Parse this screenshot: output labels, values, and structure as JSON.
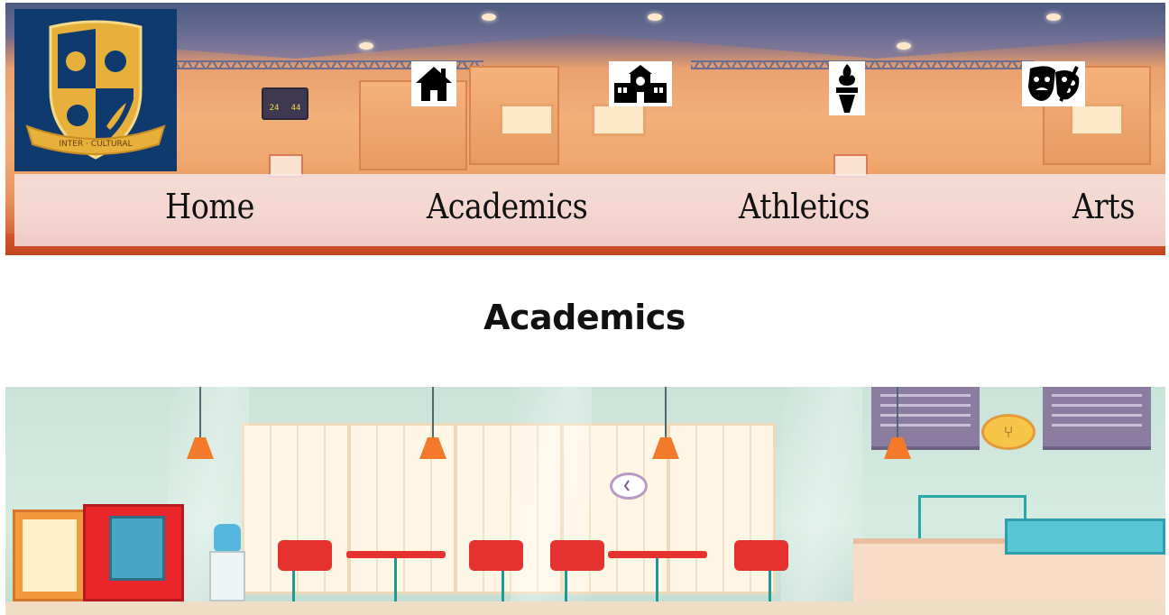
{
  "nav": {
    "items": [
      {
        "label": "Home",
        "icon": "home-icon"
      },
      {
        "label": "Academics",
        "icon": "school-building-icon"
      },
      {
        "label": "Athletics",
        "icon": "torch-icon"
      },
      {
        "label": "Arts",
        "icon": "theater-masks-palette-icon"
      }
    ]
  },
  "logo": {
    "banner_text": "INTER · CULTURAL"
  },
  "header": {
    "scoreboard_left": "24",
    "scoreboard_right": "44"
  },
  "page": {
    "title": "Academics"
  },
  "colors": {
    "logo_background": "#0f3a6d",
    "logo_gold": "#e7b03b",
    "navbar_overlay": "#f6e8ec",
    "text": "#111111"
  }
}
